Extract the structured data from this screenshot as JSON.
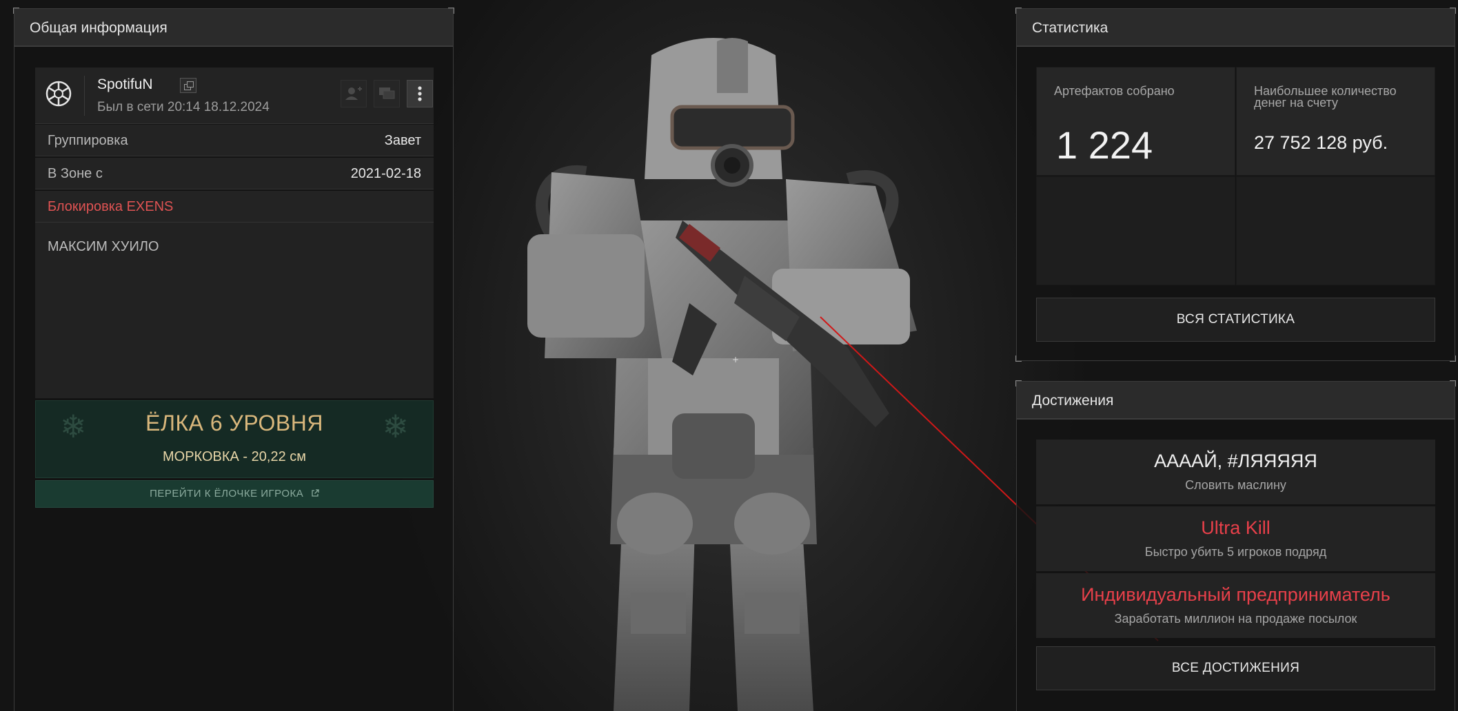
{
  "colors": {
    "accent_red": "#e05353",
    "achievement_red": "#e8404a",
    "tree_gold": "#d9b77c",
    "tree_green": "#152a24"
  },
  "info": {
    "header": "Общая информация",
    "user": {
      "nickname": "SpotifuN",
      "last_seen": "Был в сети 20:14 18.12.2024"
    },
    "rows": [
      {
        "label": "Группировка",
        "value": "Завет"
      },
      {
        "label": "В Зоне с",
        "value": "2021-02-18"
      },
      {
        "label": "Блокировка EXENS",
        "value": ""
      }
    ],
    "status": "МАКСИМ ХУИЛО",
    "tree": {
      "title": "ЁЛКА 6 УРОВНЯ",
      "subtitle": "МОРКОВКА - 20,22 см",
      "link": "ПЕРЕЙТИ К ЁЛОЧКЕ ИГРОКА"
    },
    "icons": [
      "add-friend-icon",
      "message-icon",
      "more-vertical-icon",
      "copy-icon",
      "clan-logo-icon",
      "external-link-icon",
      "snowflake-icon"
    ]
  },
  "stats": {
    "header": "Статистика",
    "cells": [
      {
        "label": "Артефактов собрано",
        "value": "1 224"
      },
      {
        "label": "Наибольшее количество денег на счету",
        "value": "27 752 128 руб."
      }
    ],
    "button": "ВСЯ СТАТИСТИКА"
  },
  "achievements": {
    "header": "Достижения",
    "items": [
      {
        "title": "ААААЙ, #ЛЯЯЯЯЯ",
        "desc": "Словить маслину",
        "color": "#f0f0f0"
      },
      {
        "title": "Ultra Kill",
        "desc": "Быстро убить 5 игроков подряд",
        "color": "#e8404a"
      },
      {
        "title": "Индивидуальный предприниматель",
        "desc": "Заработать миллион на продаже посылок",
        "color": "#e8404a"
      }
    ],
    "button": "ВСЕ ДОСТИЖЕНИЯ"
  }
}
